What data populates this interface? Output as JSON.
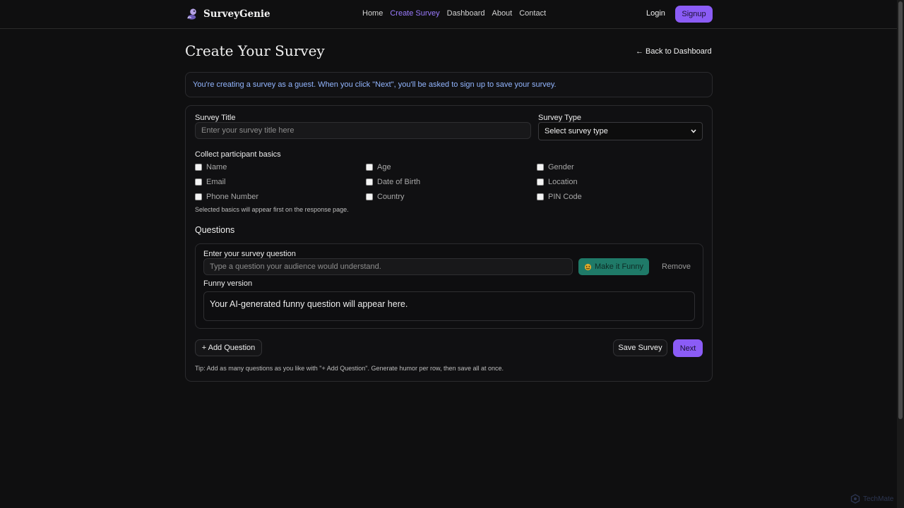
{
  "navbar": {
    "brand": "SurveyGenie",
    "links": [
      "Home",
      "Create Survey",
      "Dashboard",
      "About",
      "Contact"
    ],
    "active_link": "Create Survey",
    "login_label": "Login",
    "signup_label": "Signup"
  },
  "header": {
    "title": "Create Your Survey",
    "back_label": "← Back to Dashboard"
  },
  "banner": {
    "text": "You're creating a survey as a guest. When you click \"Next\", you'll be asked to sign up to save your survey."
  },
  "form": {
    "title_label": "Survey Title",
    "title_placeholder": "Enter your survey title here",
    "type_label": "Survey Type",
    "type_selected": "Select survey type",
    "basics_label": "Collect participant basics",
    "basics_options": [
      "Name",
      "Age",
      "Gender",
      "Email",
      "Date of Birth",
      "Location",
      "Phone Number",
      "Country",
      "PIN Code"
    ],
    "basics_hint": "Selected basics will appear first on the response page.",
    "questions_title": "Questions",
    "question_label": "Enter your survey question",
    "question_placeholder": "Type a question your audience would understand.",
    "funny_button": "Make it Funny",
    "remove_button": "Remove",
    "funny_label": "Funny version",
    "funny_placeholder": "Your AI-generated funny question will appear here.",
    "add_question": "+ Add Question",
    "save_survey": "Save Survey",
    "next": "Next",
    "tip": "Tip: Add as many questions as you like with \"+ Add Question\". Generate humor per row, then save all at once."
  },
  "colors": {
    "accent": "#8b5cf6",
    "banner_text": "#93b6ff",
    "funny_button": "#1f7a68",
    "background": "#0f0f10"
  },
  "watermark": {
    "text": "TechMate"
  }
}
